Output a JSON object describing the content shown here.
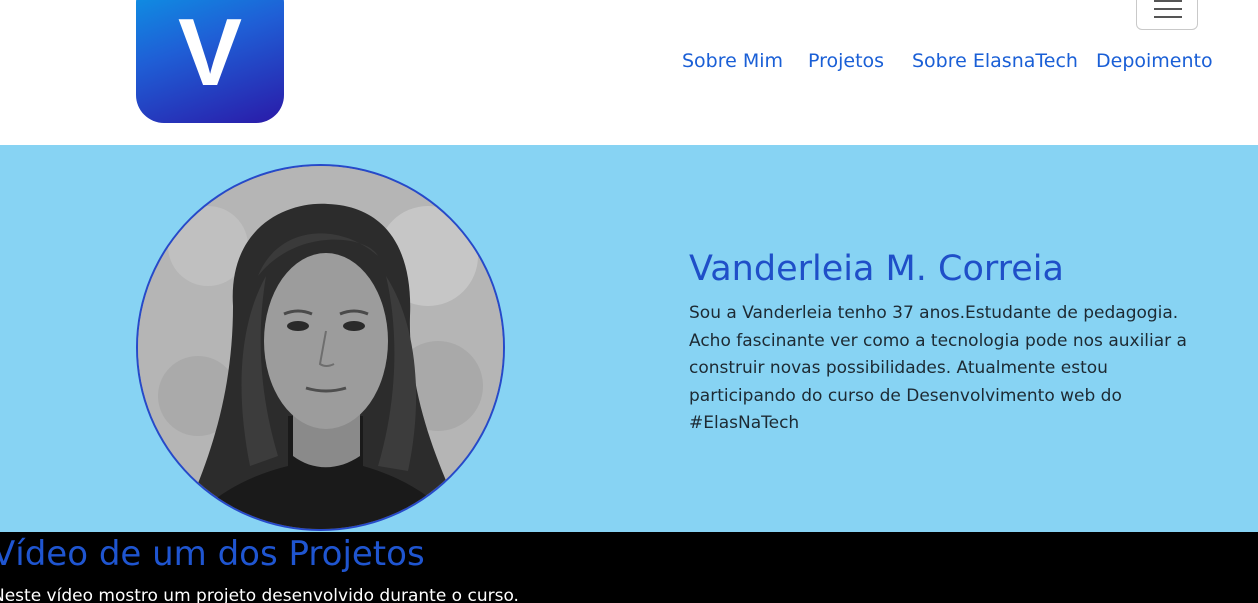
{
  "brand": {
    "logo_letter": "V"
  },
  "navbar": {
    "items": [
      {
        "label": "Sobre Mim"
      },
      {
        "label": "Projetos"
      },
      {
        "label": "Sobre ElasnaTech"
      },
      {
        "label": "Depoimento"
      }
    ],
    "toggler_icon": "hamburger-menu-icon"
  },
  "profile": {
    "name": "Vanderleia M. Correia",
    "bio": "Sou a Vanderleia tenho 37 anos.Estudante de pedagogia. Acho fascinante ver como a tecnologia pode nos auxiliar a construir novas possibilidades. Atualmente estou participando do curso de Desenvolvimento web do #ElasNaTech"
  },
  "video_section": {
    "title": "Vídeo de um dos Projetos",
    "description": "Neste vídeo mostro um projeto desenvolvido durante o curso."
  },
  "colors": {
    "accent": "#1a5fd6",
    "hero_background": "#87d3f3",
    "section_background": "#000000"
  }
}
